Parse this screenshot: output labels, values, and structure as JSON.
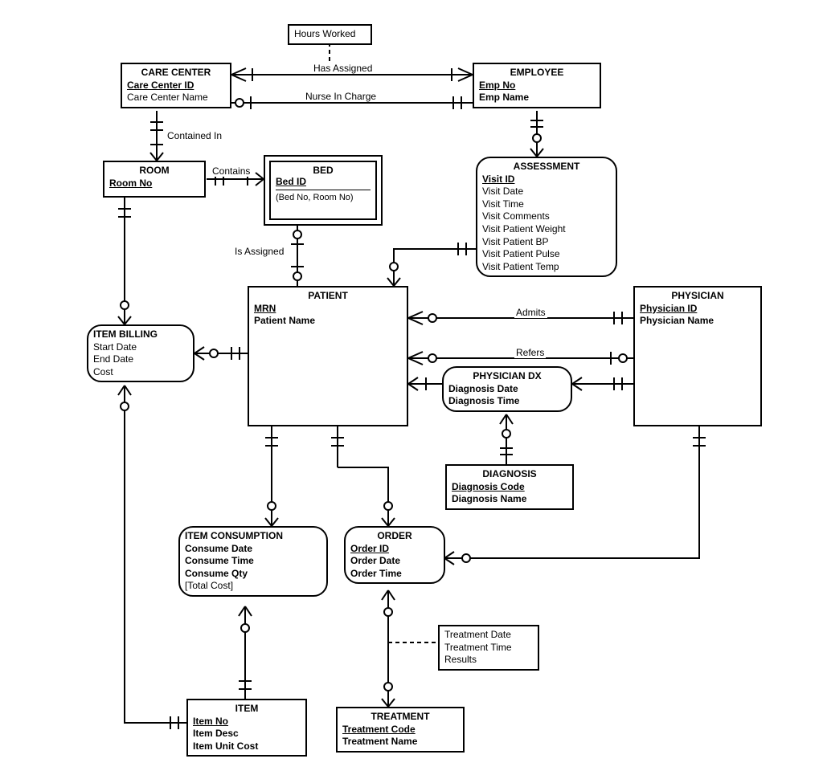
{
  "entities": {
    "care_center": {
      "title": "CARE CENTER",
      "pk": "Care Center ID",
      "attrs": [
        "Care Center Name"
      ]
    },
    "employee": {
      "title": "EMPLOYEE",
      "pk": "Emp No",
      "attrs_b": [
        "Emp Name"
      ]
    },
    "room": {
      "title": "ROOM",
      "pk": "Room No"
    },
    "bed": {
      "title": "BED",
      "pk": "Bed ID",
      "composite": "(Bed No, Room No)"
    },
    "assessment": {
      "title": "ASSESSMENT",
      "pk": "Visit ID",
      "attrs": [
        "Visit Date",
        "Visit Time",
        "Visit Comments",
        "Visit Patient Weight",
        "Visit Patient BP",
        "Visit Patient Pulse",
        "Visit Patient Temp"
      ]
    },
    "patient": {
      "title": "PATIENT",
      "pk": "MRN",
      "attrs_b": [
        "Patient Name"
      ]
    },
    "physician": {
      "title": "PHYSICIAN",
      "pk": "Physician ID",
      "attrs_b": [
        "Physician Name"
      ]
    },
    "item_billing": {
      "title": "ITEM BILLING",
      "attrs": [
        "Start Date",
        "End Date",
        "Cost"
      ]
    },
    "physician_dx": {
      "title": "PHYSICIAN DX",
      "attrs_b": [
        "Diagnosis Date",
        "Diagnosis Time"
      ]
    },
    "diagnosis": {
      "title": "DIAGNOSIS",
      "pk": "Diagnosis Code",
      "attrs_b": [
        "Diagnosis Name"
      ]
    },
    "item_consumption": {
      "title": "ITEM CONSUMPTION",
      "attrs_b": [
        "Consume Date",
        "Consume Time",
        "Consume Qty"
      ],
      "derived": "[Total Cost]"
    },
    "order": {
      "title": "ORDER",
      "pk": "Order ID",
      "attrs_b": [
        "Order Date",
        "Order Time"
      ]
    },
    "item": {
      "title": "ITEM",
      "pk": "Item No",
      "attrs_b": [
        "Item Desc",
        "Item Unit Cost"
      ]
    },
    "treatment": {
      "title": "TREATMENT",
      "pk": "Treatment Code",
      "attrs_b": [
        "Treatment Name"
      ]
    }
  },
  "attr_boxes": {
    "hours_worked": "Hours Worked",
    "treatment_attrs": [
      "Treatment Date",
      "Treatment Time",
      "Results"
    ]
  },
  "relationships": {
    "has_assigned": "Has Assigned",
    "nurse_in_charge": "Nurse In Charge",
    "contained_in": "Contained In",
    "contains": "Contains",
    "is_assigned": "Is Assigned",
    "admits": "Admits",
    "refers": "Refers"
  }
}
